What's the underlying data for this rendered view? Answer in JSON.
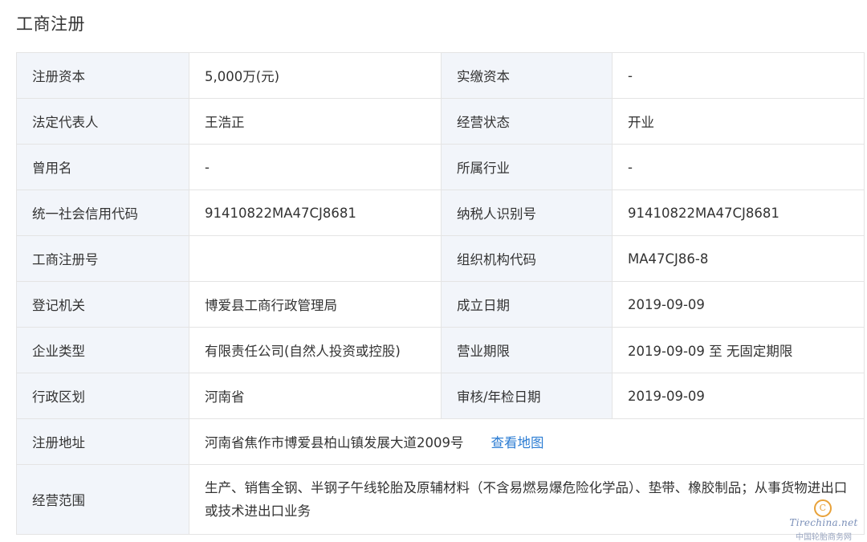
{
  "section_title": "工商注册",
  "rows": [
    {
      "k1": "注册资本",
      "v1": "5,000万(元)",
      "k2": "实缴资本",
      "v2": "-"
    },
    {
      "k1": "法定代表人",
      "v1": "王浩正",
      "k2": "经营状态",
      "v2": "开业"
    },
    {
      "k1": "曾用名",
      "v1": "-",
      "k2": "所属行业",
      "v2": "-"
    },
    {
      "k1": "统一社会信用代码",
      "v1": "91410822MA47CJ8681",
      "k2": "纳税人识别号",
      "v2": "91410822MA47CJ8681"
    },
    {
      "k1": "工商注册号",
      "v1": "",
      "k2": "组织机构代码",
      "v2": "MA47CJ86-8"
    },
    {
      "k1": "登记机关",
      "v1": "博爱县工商行政管理局",
      "k2": "成立日期",
      "v2": "2019-09-09"
    },
    {
      "k1": "企业类型",
      "v1": "有限责任公司(自然人投资或控股)",
      "k2": "营业期限",
      "v2": "2019-09-09 至 无固定期限"
    },
    {
      "k1": "行政区划",
      "v1": "河南省",
      "k2": "审核/年检日期",
      "v2": "2019-09-09"
    }
  ],
  "address": {
    "label": "注册地址",
    "value": "河南省焦作市博爱县柏山镇发展大道2009号",
    "map_link": "查看地图"
  },
  "scope": {
    "label": "经营范围",
    "value": "生产、销售全钢、半钢子午线轮胎及原辅材料（不含易燃易爆危险化学品）、垫带、橡胶制品；从事货物进出口或技术进出口业务"
  },
  "watermark": {
    "logo_text": "Tirechina.net",
    "caption": "中国轮胎商务网"
  }
}
